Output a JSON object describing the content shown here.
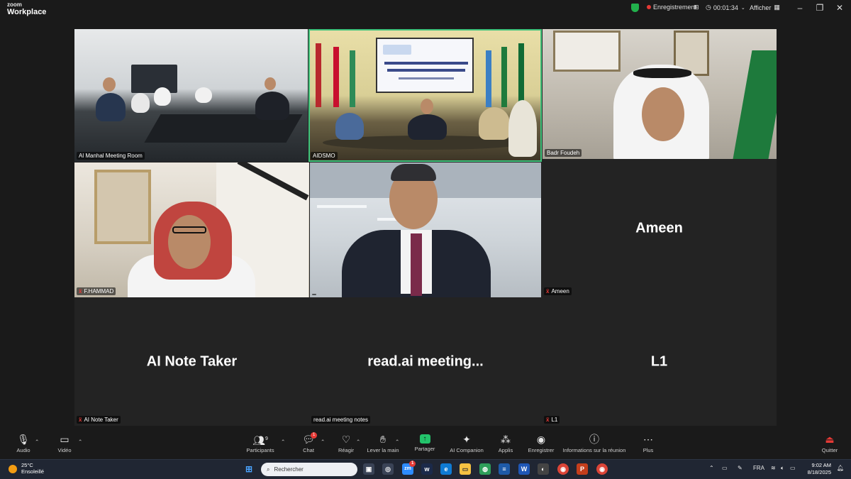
{
  "app": {
    "logo_line1": "zoom",
    "logo_line2": "Workplace"
  },
  "titlebar": {
    "recording_label": "Enregistrement",
    "timer": "00:01:34",
    "view_label": "Afficher",
    "colors": {
      "shield": "#22b14c",
      "rec_dot": "#e53935"
    }
  },
  "participants": [
    {
      "name": "Al Manhal Meeting Room",
      "type": "video",
      "scene": "meeting-room"
    },
    {
      "name": "AIDSMO",
      "type": "video",
      "scene": "conference-hall",
      "active_speaker": true
    },
    {
      "name": "Badr Foudeh",
      "type": "video",
      "scene": "office"
    },
    {
      "name": "F.HAMMAD",
      "type": "video",
      "scene": "office",
      "muted": true
    },
    {
      "name": "",
      "type": "video",
      "scene": "glass-office"
    },
    {
      "name": "Ameen",
      "display": "Ameen",
      "type": "avatar",
      "muted": true
    },
    {
      "name": "AI Note Taker",
      "display": "AI Note Taker",
      "type": "avatar",
      "muted": true
    },
    {
      "name": "read.ai meeting notes",
      "display": "read.ai  meeting...",
      "type": "avatar"
    },
    {
      "name": "L1",
      "display": "L1",
      "type": "avatar",
      "muted": true
    }
  ],
  "toolbar": {
    "audio": "Audio",
    "video": "Vidéo",
    "participants": "Participants",
    "participants_count": "9",
    "chat": "Chat",
    "chat_badge": "1",
    "react": "Réagir",
    "raise_hand": "Lever la main",
    "share": "Partager",
    "ai_companion": "AI Companion",
    "apps": "Applis",
    "record": "Enregistrer",
    "info": "Informations sur la réunion",
    "more": "Plus",
    "quit": "Quitter",
    "accent": "#23c46b"
  },
  "taskbar": {
    "weather_temp": "25°C",
    "weather_text": "Ensoleillé",
    "search_placeholder": "Rechercher",
    "language": "FRA",
    "time": "9:02 AM",
    "date": "8/18/2025",
    "app_badge": "1"
  }
}
